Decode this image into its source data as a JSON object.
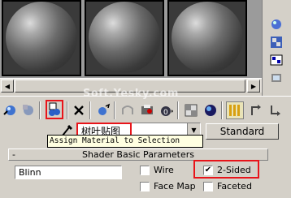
{
  "slots": [
    {
      "name": "sample-slot-1"
    },
    {
      "name": "sample-slot-2"
    },
    {
      "name": "sample-slot-3"
    }
  ],
  "watermark": "Soft.Yesky.com",
  "material": {
    "name": "树叶贴图",
    "type_button": "Standard"
  },
  "tooltip": "Assign Material to Selection",
  "rollout": {
    "title": "Shader Basic Parameters",
    "collapse": "-"
  },
  "shader": {
    "selected": "Blinn"
  },
  "options": {
    "wire": "Wire",
    "two_sided": "2-Sided",
    "face_map": "Face Map",
    "faceted": "Faceted"
  },
  "checks": {
    "wire": false,
    "two_sided": true,
    "face_map": false,
    "faceted": false
  },
  "colors": {
    "highlight": "#e8141a",
    "tooltip_bg": "#ffffe1"
  }
}
